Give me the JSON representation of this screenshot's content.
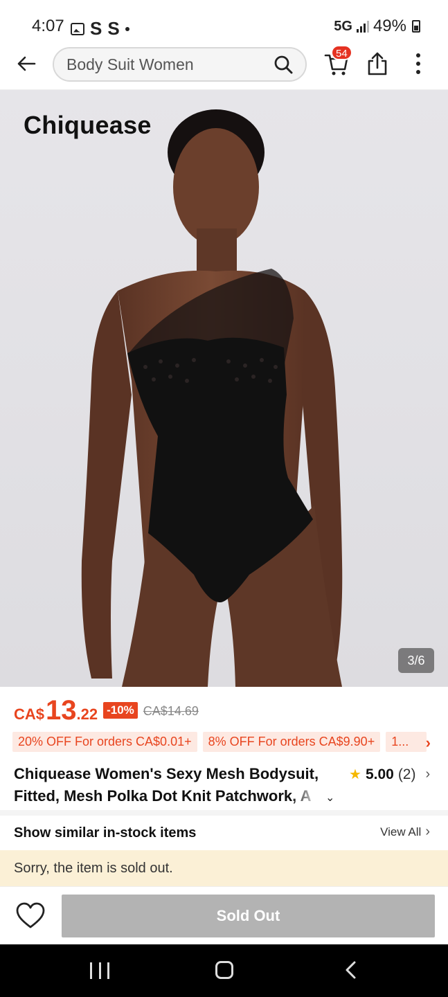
{
  "status_bar": {
    "time": "4:07",
    "carrier_letters": [
      "S",
      "S"
    ],
    "network": "5G",
    "battery": "49%"
  },
  "header": {
    "search_text": "Body Suit Women",
    "cart_count": "54"
  },
  "gallery": {
    "brand_logo_text": "Chiquease",
    "image_counter": "3/6"
  },
  "price": {
    "currency": "CA$",
    "whole": "13",
    "cents": ".22",
    "discount": "-10%",
    "original": "CA$14.69",
    "accent_color": "#e8451f"
  },
  "coupons": [
    "20% OFF For orders CA$0.01+",
    "8% OFF For orders CA$9.90+",
    "1..."
  ],
  "product": {
    "title": "Chiquease Women's Sexy Mesh Bodysuit, Fitted, Mesh Polka Dot Knit Patchwork, A",
    "rating": "5.00",
    "review_count": "(2)"
  },
  "similar": {
    "label": "Show similar in-stock items",
    "view_all": "View All"
  },
  "notice": {
    "sold_out_message": "Sorry, the item is sold out."
  },
  "actions": {
    "sold_out_label": "Sold Out"
  }
}
